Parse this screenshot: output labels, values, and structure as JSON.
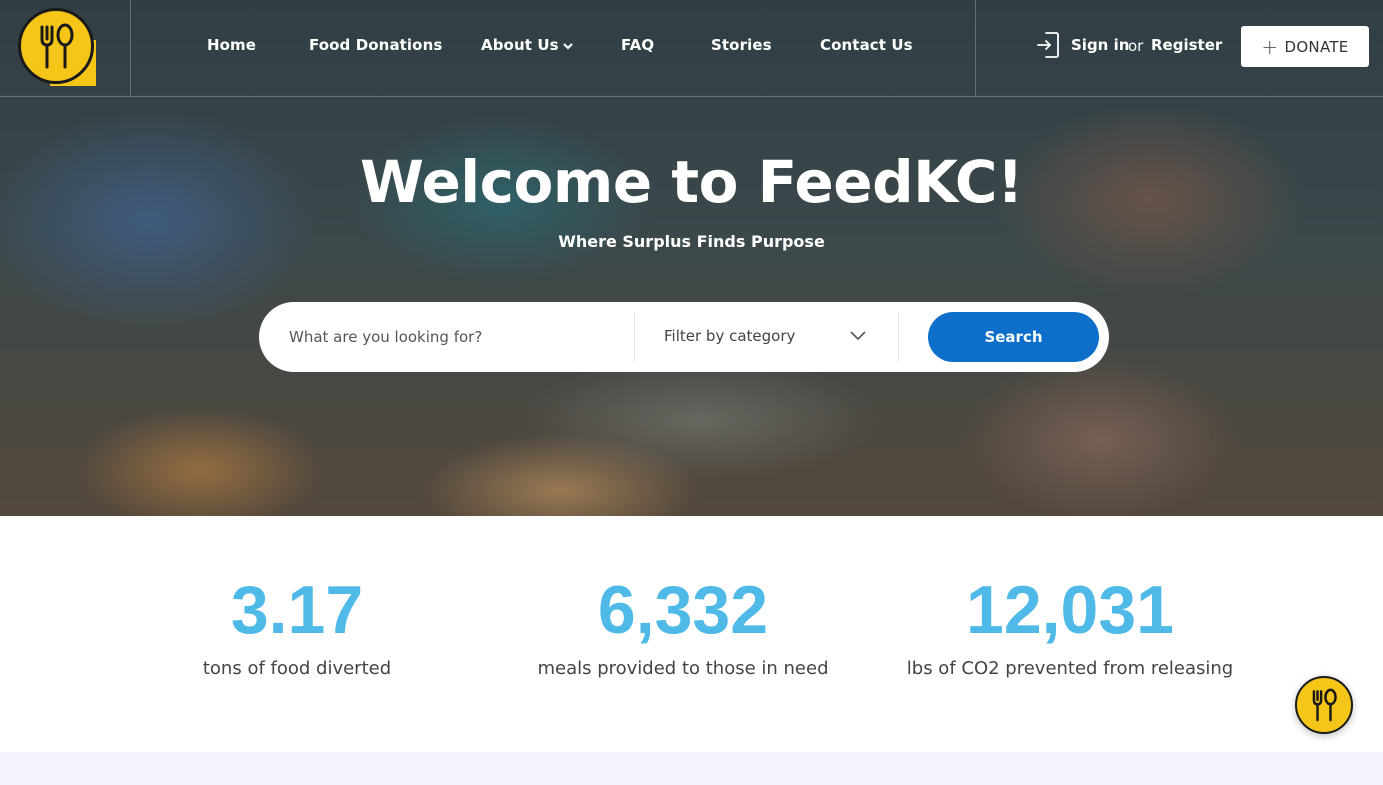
{
  "brand": {
    "logo_icon": "fork-spoon-icon",
    "accent": "#f5c518"
  },
  "nav": {
    "items": [
      {
        "label": "Home"
      },
      {
        "label": "Food Donations"
      },
      {
        "label": "About Us",
        "has_dropdown": true
      },
      {
        "label": "FAQ"
      },
      {
        "label": "Stories"
      },
      {
        "label": "Contact Us"
      }
    ],
    "sign_in": "Sign in",
    "or": "or",
    "register": "Register",
    "donate_icon": "plus-icon",
    "donate": "DONATE"
  },
  "hero": {
    "title": "Welcome to FeedKC!",
    "subtitle": "Where Surplus Finds Purpose"
  },
  "search": {
    "placeholder": "What are you looking for?",
    "filter_label": "Filter by category",
    "button": "Search",
    "button_color": "#0d6fc9"
  },
  "stats": [
    {
      "value": "3.17",
      "label": "tons of food diverted"
    },
    {
      "value": "6,332",
      "label": "meals provided to those in need"
    },
    {
      "value": "12,031",
      "label": "lbs of CO2 prevented from releasing"
    }
  ],
  "stats_color": "#4fb9e8",
  "chat": {
    "icon": "fork-spoon-icon"
  }
}
